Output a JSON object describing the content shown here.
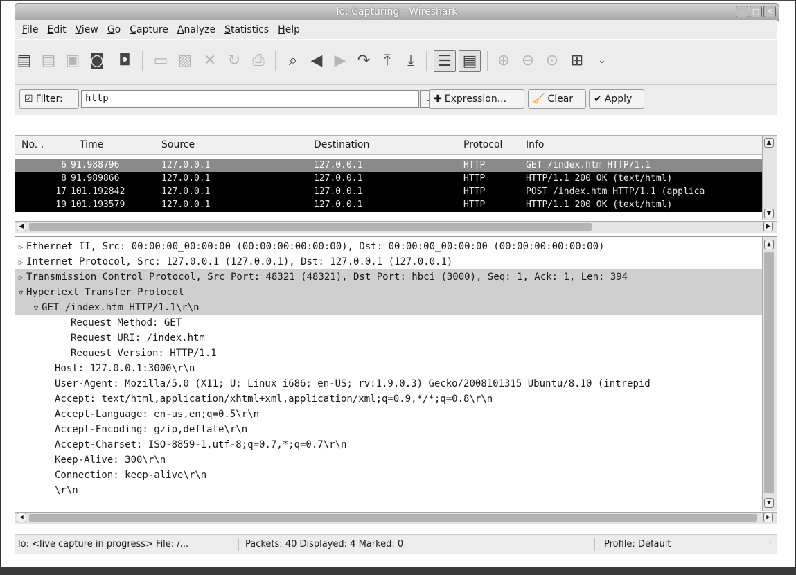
{
  "window": {
    "title": "lo: Capturing - Wireshark"
  },
  "menu": [
    "File",
    "Edit",
    "View",
    "Go",
    "Capture",
    "Analyze",
    "Statistics",
    "Help"
  ],
  "filter": {
    "label": "Filter:",
    "value": "http",
    "expression_label": "Expression...",
    "clear_label": "Clear",
    "apply_label": "Apply"
  },
  "packet_list": {
    "columns": [
      "No. .",
      "Time",
      "Source",
      "Destination",
      "Protocol",
      "Info"
    ],
    "rows": [
      {
        "no": "6",
        "time": "91.988796",
        "src": "127.0.0.1",
        "dst": "127.0.0.1",
        "proto": "HTTP",
        "info": "GET /index.htm HTTP/1.1"
      },
      {
        "no": "8",
        "time": "91.989866",
        "src": "127.0.0.1",
        "dst": "127.0.0.1",
        "proto": "HTTP",
        "info": "HTTP/1.1 200 OK  (text/html)"
      },
      {
        "no": "17",
        "time": "101.192842",
        "src": "127.0.0.1",
        "dst": "127.0.0.1",
        "proto": "HTTP",
        "info": "POST /index.htm HTTP/1.1  (applica"
      },
      {
        "no": "19",
        "time": "101.193579",
        "src": "127.0.0.1",
        "dst": "127.0.0.1",
        "proto": "HTTP",
        "info": "HTTP/1.1 200 OK  (text/html)"
      }
    ]
  },
  "details": {
    "lines": [
      "Ethernet II, Src: 00:00:00_00:00:00 (00:00:00:00:00:00), Dst: 00:00:00_00:00:00 (00:00:00:00:00:00)",
      "Internet Protocol, Src: 127.0.0.1 (127.0.0.1), Dst: 127.0.0.1 (127.0.0.1)",
      "Transmission Control Protocol, Src Port: 48321 (48321), Dst Port: hbci (3000), Seq: 1, Ack: 1, Len: 394",
      "Hypertext Transfer Protocol",
      "GET /index.htm HTTP/1.1\\r\\n",
      "Request Method: GET",
      "Request URI: /index.htm",
      "Request Version: HTTP/1.1",
      "Host: 127.0.0.1:3000\\r\\n",
      "User-Agent: Mozilla/5.0 (X11; U; Linux i686; en-US; rv:1.9.0.3) Gecko/2008101315 Ubuntu/8.10 (intrepid",
      "Accept: text/html,application/xhtml+xml,application/xml;q=0.9,*/*;q=0.8\\r\\n",
      "Accept-Language: en-us,en;q=0.5\\r\\n",
      "Accept-Encoding: gzip,deflate\\r\\n",
      "Accept-Charset: ISO-8859-1,utf-8;q=0.7,*;q=0.7\\r\\n",
      "Keep-Alive: 300\\r\\n",
      "Connection: keep-alive\\r\\n",
      "\\r\\n"
    ]
  },
  "status": {
    "capture": "lo: <live capture in progress> File: /...",
    "packets": "Packets: 40 Displayed: 4 Marked: 0",
    "profile": "Profile: Default"
  }
}
